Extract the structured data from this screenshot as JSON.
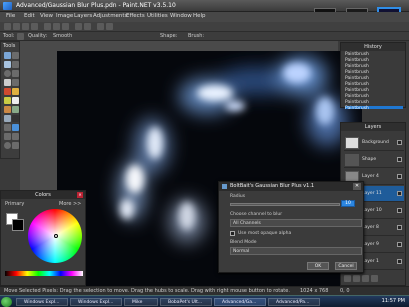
{
  "title": "Advanced/Gaussian Blur Plus.pdn - Paint.NET v3.5.10",
  "menu": [
    "File",
    "Edit",
    "View",
    "Image",
    "Layers",
    "Adjustments",
    "Effects",
    "Utilities",
    "Window",
    "Help"
  ],
  "toolbar": {
    "tool_label": "Tool:",
    "quality_label": "Quality:",
    "quality_value": "Smooth",
    "shape_label": "Shape:",
    "brush_label": "Brush:"
  },
  "history": {
    "title": "History",
    "items": [
      "Paintbrush",
      "Paintbrush",
      "Paintbrush",
      "Paintbrush",
      "Paintbrush",
      "Paintbrush",
      "Paintbrush",
      "Paintbrush",
      "Paintbrush",
      "Paintbrush"
    ],
    "selected_index": 9
  },
  "layers": {
    "title": "Layers",
    "items": [
      {
        "name": "Background"
      },
      {
        "name": "Shape"
      },
      {
        "name": "Layer 4"
      },
      {
        "name": "Layer 11"
      },
      {
        "name": "Layer 10"
      },
      {
        "name": "Layer 8"
      },
      {
        "name": "Layer 9"
      },
      {
        "name": "Layer 1"
      }
    ],
    "selected_index": 3
  },
  "colors": {
    "title": "Colors",
    "primary_label": "Primary",
    "more_label": "More >>",
    "primary_color": "#ffffff",
    "secondary_color": "#000000"
  },
  "dialog": {
    "title": "BoltBait's Gaussian Blur Plus v1.1",
    "radius_label": "Radius",
    "radius_value": "10",
    "channel_label": "Choose channel to blur",
    "channel_value": "All Channels",
    "alpha_label": "Use most opaque alpha",
    "blend_label": "Blend Mode",
    "blend_value": "Normal",
    "ok": "OK",
    "cancel": "Cancel"
  },
  "status": {
    "text": "Move Selected Pixels: Drag the selection to move. Drag the hubs to scale. Drag with right mouse button to rotate.",
    "size": "1024 x 768",
    "pos": "0, 0"
  },
  "taskbar": {
    "items": [
      "Windows Expl...",
      "Windows Expl...",
      "Mike",
      "BobaPet's Ult...",
      "Advanced/Ga...",
      "Advanced/Pa..."
    ],
    "active_index": 4,
    "clock": "11:57 PM"
  },
  "accent_color": "#1f77d1"
}
